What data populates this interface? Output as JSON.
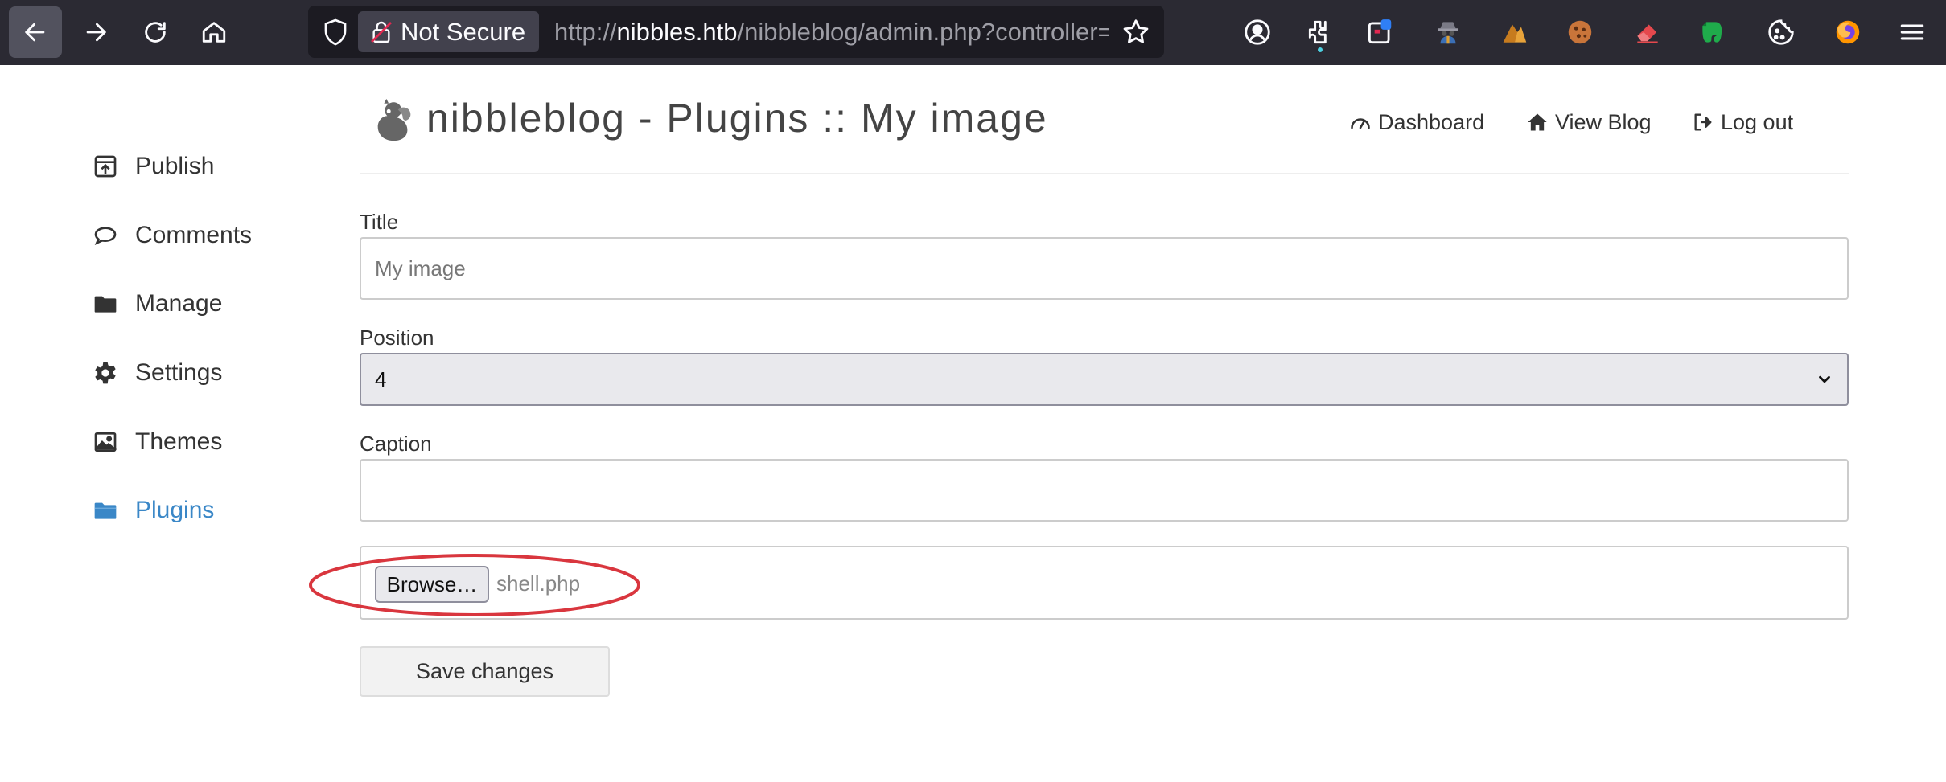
{
  "browser": {
    "security_label": "Not Secure",
    "url_prefix": "http://",
    "url_host": "nibbles.htb",
    "url_path": "/nibbleblog/admin.php?controller=plugins&action=config&plugin=my_image",
    "extensions": [
      "account-icon",
      "extensions-icon",
      "container-icon",
      "spy-icon",
      "wappalyzer-icon",
      "cookie-icon",
      "eraser-icon",
      "evernote-icon",
      "cookie-editor-icon",
      "firefox-icon",
      "menu-icon"
    ]
  },
  "sidebar": {
    "items": [
      {
        "label": "Publish",
        "icon": "publish-icon"
      },
      {
        "label": "Comments",
        "icon": "comment-icon"
      },
      {
        "label": "Manage",
        "icon": "folder-icon"
      },
      {
        "label": "Settings",
        "icon": "gear-icon"
      },
      {
        "label": "Themes",
        "icon": "image-icon"
      },
      {
        "label": "Plugins",
        "icon": "folder-open-icon",
        "active": true
      }
    ]
  },
  "header": {
    "title": "nibbleblog - Plugins :: My image",
    "links": {
      "dashboard": "Dashboard",
      "view_blog": "View Blog",
      "logout": "Log out"
    }
  },
  "form": {
    "title_label": "Title",
    "title_value": "My image",
    "position_label": "Position",
    "position_value": "4",
    "caption_label": "Caption",
    "caption_value": "",
    "browse_label": "Browse…",
    "file_name": "shell.php",
    "save_label": "Save changes"
  },
  "colors": {
    "accent": "#3a87c7",
    "chrome_bg": "#2b2a33",
    "annotation": "#d9363e"
  }
}
